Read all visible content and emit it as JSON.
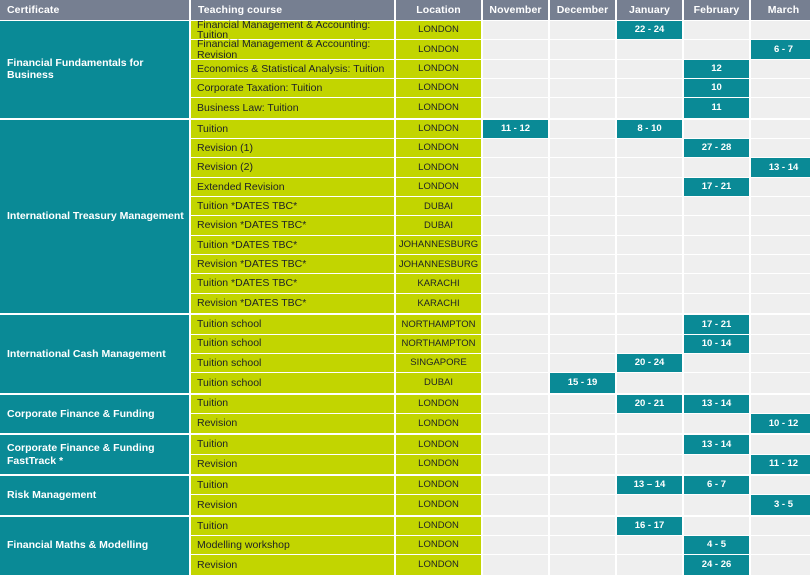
{
  "table": {
    "columns": [
      {
        "key": "certificate",
        "label": "Certificate",
        "align": "left"
      },
      {
        "key": "course",
        "label": "Teaching course",
        "align": "left"
      },
      {
        "key": "location",
        "label": "Location",
        "align": "center"
      },
      {
        "key": "november",
        "label": "November",
        "align": "center"
      },
      {
        "key": "december",
        "label": "December",
        "align": "center"
      },
      {
        "key": "january",
        "label": "January",
        "align": "center"
      },
      {
        "key": "february",
        "label": "February",
        "align": "center"
      },
      {
        "key": "march",
        "label": "March",
        "align": "center"
      }
    ],
    "colors": {
      "header_background": "#767f91",
      "certificate_background": "#0a8a96",
      "course_background": "#c2d500",
      "date_filled_background": "#0a8a96",
      "date_empty_background": "#efefef",
      "grid_gap": "#ffffff"
    },
    "groups": [
      {
        "certificate": "Financial Fundamentals for Business",
        "rows": [
          {
            "course": "Financial Management & Accounting: Tuition",
            "location": "LONDON",
            "november": "",
            "december": "",
            "january": "22 - 24",
            "february": "",
            "march": ""
          },
          {
            "course": "Financial Management & Accounting: Revision",
            "location": "LONDON",
            "november": "",
            "december": "",
            "january": "",
            "february": "",
            "march": "6 - 7"
          },
          {
            "course": "Economics & Statistical Analysis: Tuition",
            "location": "LONDON",
            "november": "",
            "december": "",
            "january": "",
            "february": "12",
            "march": ""
          },
          {
            "course": "Corporate Taxation: Tuition",
            "location": "LONDON",
            "november": "",
            "december": "",
            "january": "",
            "february": "10",
            "march": ""
          },
          {
            "course": "Business Law: Tuition",
            "location": "LONDON",
            "november": "",
            "december": "",
            "january": "",
            "february": "11",
            "march": ""
          }
        ]
      },
      {
        "certificate": "International Treasury Management",
        "rows": [
          {
            "course": "Tuition",
            "location": "LONDON",
            "november": "11 - 12",
            "december": "",
            "january": "8 - 10",
            "february": "",
            "march": ""
          },
          {
            "course": "Revision (1)",
            "location": "LONDON",
            "november": "",
            "december": "",
            "january": "",
            "february": "27 - 28",
            "march": ""
          },
          {
            "course": "Revision (2)",
            "location": "LONDON",
            "november": "",
            "december": "",
            "january": "",
            "february": "",
            "march": "13 - 14"
          },
          {
            "course": "Extended Revision",
            "location": "LONDON",
            "november": "",
            "december": "",
            "january": "",
            "february": "17 - 21",
            "march": ""
          },
          {
            "course": "Tuition *DATES TBC*",
            "location": "DUBAI",
            "november": "",
            "december": "",
            "january": "",
            "february": "",
            "march": ""
          },
          {
            "course": "Revision *DATES TBC*",
            "location": "DUBAI",
            "november": "",
            "december": "",
            "january": "",
            "february": "",
            "march": ""
          },
          {
            "course": "Tuition *DATES TBC*",
            "location": "JOHANNESBURG",
            "november": "",
            "december": "",
            "january": "",
            "february": "",
            "march": ""
          },
          {
            "course": "Revision *DATES TBC*",
            "location": "JOHANNESBURG",
            "november": "",
            "december": "",
            "january": "",
            "february": "",
            "march": ""
          },
          {
            "course": "Tuition *DATES TBC*",
            "location": "KARACHI",
            "november": "",
            "december": "",
            "january": "",
            "february": "",
            "march": ""
          },
          {
            "course": "Revision *DATES TBC*",
            "location": "KARACHI",
            "november": "",
            "december": "",
            "january": "",
            "february": "",
            "march": ""
          }
        ]
      },
      {
        "certificate": "International Cash Management",
        "rows": [
          {
            "course": "Tuition school",
            "location": "NORTHAMPTON",
            "november": "",
            "december": "",
            "january": "",
            "february": "17 - 21",
            "march": ""
          },
          {
            "course": "Tuition school",
            "location": "NORTHAMPTON",
            "november": "",
            "december": "",
            "january": "",
            "february": "10 - 14",
            "march": ""
          },
          {
            "course": "Tuition school",
            "location": "SINGAPORE",
            "november": "",
            "december": "",
            "january": "20 - 24",
            "february": "",
            "march": ""
          },
          {
            "course": "Tuition school",
            "location": "DUBAI",
            "november": "",
            "december": "15 - 19",
            "january": "",
            "february": "",
            "march": ""
          }
        ]
      },
      {
        "certificate": "Corporate Finance & Funding",
        "rows": [
          {
            "course": "Tuition",
            "location": "LONDON",
            "november": "",
            "december": "",
            "january": "20 - 21",
            "february": "13 - 14",
            "march": ""
          },
          {
            "course": "Revision",
            "location": "LONDON",
            "november": "",
            "december": "",
            "january": "",
            "february": "",
            "march": "10 - 12"
          }
        ]
      },
      {
        "certificate": "Corporate Finance & Funding FastTrack *",
        "rows": [
          {
            "course": "Tuition",
            "location": "LONDON",
            "november": "",
            "december": "",
            "january": "",
            "february": "13 - 14",
            "march": ""
          },
          {
            "course": "Revision",
            "location": "LONDON",
            "november": "",
            "december": "",
            "january": "",
            "february": "",
            "march": "11 - 12"
          }
        ]
      },
      {
        "certificate": "Risk Management",
        "rows": [
          {
            "course": "Tuition",
            "location": "LONDON",
            "november": "",
            "december": "",
            "january": "13 – 14",
            "february": "6 - 7",
            "march": ""
          },
          {
            "course": "Revision",
            "location": "LONDON",
            "november": "",
            "december": "",
            "january": "",
            "february": "",
            "march": "3 - 5"
          }
        ]
      },
      {
        "certificate": "Financial Maths & Modelling",
        "rows": [
          {
            "course": "Tuition",
            "location": "LONDON",
            "november": "",
            "december": "",
            "january": "16 - 17",
            "february": "",
            "march": ""
          },
          {
            "course": "Modelling workshop",
            "location": "LONDON",
            "november": "",
            "december": "",
            "january": "",
            "february": "4 - 5",
            "march": ""
          },
          {
            "course": "Revision",
            "location": "LONDON",
            "november": "",
            "december": "",
            "january": "",
            "february": "24 - 26",
            "march": ""
          }
        ]
      }
    ]
  }
}
